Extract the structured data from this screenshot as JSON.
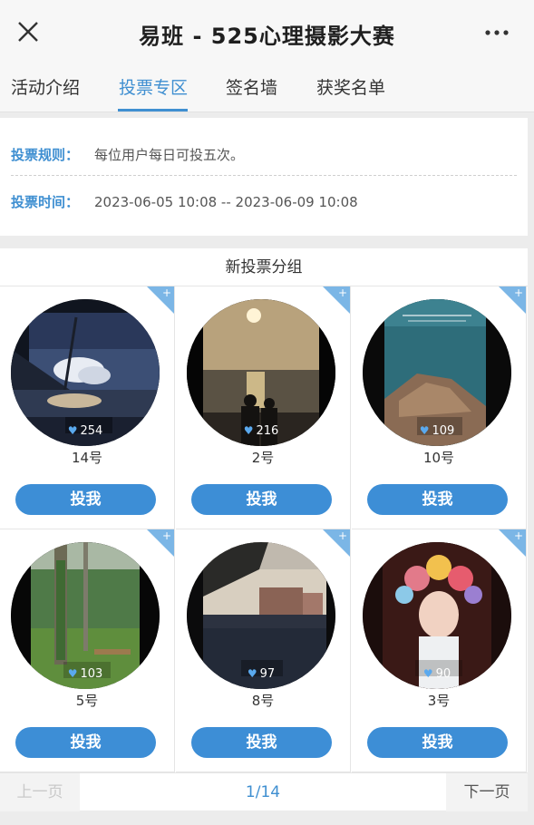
{
  "nav": {
    "title": "易班 - 525心理摄影大赛",
    "close_icon": "close-icon",
    "more_icon": "more-icon"
  },
  "tabs": [
    {
      "label": "活动介绍",
      "active": false
    },
    {
      "label": "投票专区",
      "active": true
    },
    {
      "label": "签名墙",
      "active": false
    },
    {
      "label": "获奖名单",
      "active": false
    }
  ],
  "rules": {
    "rule_label": "投票规则：",
    "rule_text": "每位用户每日可投五次。",
    "time_label": "投票时间：",
    "time_text": "2023-06-05 10:08 -- 2023-06-09 10:08"
  },
  "group": {
    "title": "新投票分组",
    "entries": [
      {
        "number": "14号",
        "likes": "254",
        "vote_label": "投我"
      },
      {
        "number": "2号",
        "likes": "216",
        "vote_label": "投我"
      },
      {
        "number": "10号",
        "likes": "109",
        "vote_label": "投我"
      },
      {
        "number": "5号",
        "likes": "103",
        "vote_label": "投我"
      },
      {
        "number": "8号",
        "likes": "97",
        "vote_label": "投我"
      },
      {
        "number": "3号",
        "likes": "90",
        "vote_label": "投我"
      }
    ]
  },
  "pager": {
    "prev": "上一页",
    "page": "1/14",
    "next": "下一页"
  },
  "colors": {
    "accent": "#3d8ed6",
    "corner": "#7bb6e6"
  }
}
